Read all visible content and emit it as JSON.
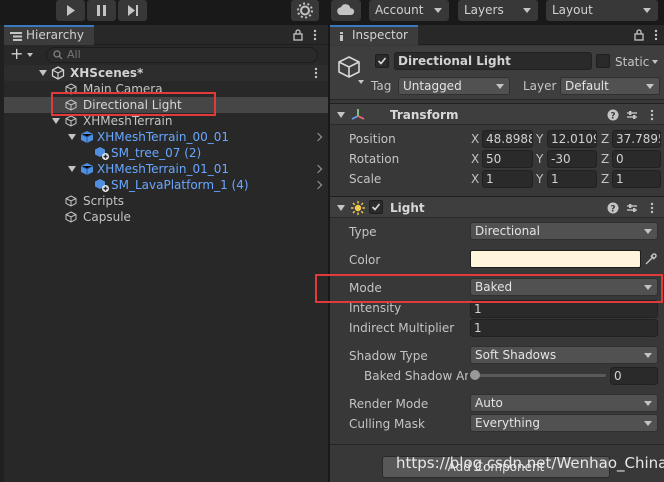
{
  "toolbar": {
    "account_label": "Account",
    "layers_label": "Layers",
    "layout_label": "Layout"
  },
  "hierarchy": {
    "tab_label": "Hierarchy",
    "search_placeholder": "All",
    "scene_name": "XHScenes*",
    "items": [
      {
        "label": "Main Camera"
      },
      {
        "label": "Directional Light"
      },
      {
        "label": "XHMeshTerrain"
      },
      {
        "label": "XHMeshTerrain_00_01"
      },
      {
        "label": "SM_tree_07 (2)"
      },
      {
        "label": "XHMeshTerrain_01_01"
      },
      {
        "label": "SM_LavaPlatform_1 (4)"
      },
      {
        "label": "Scripts"
      },
      {
        "label": "Capsule"
      }
    ]
  },
  "inspector": {
    "tab_label": "Inspector",
    "object_name": "Directional Light",
    "static_label": "Static",
    "tag_label": "Tag",
    "tag_value": "Untagged",
    "layer_label": "Layer",
    "layer_value": "Default",
    "transform": {
      "title": "Transform",
      "position_label": "Position",
      "rotation_label": "Rotation",
      "scale_label": "Scale",
      "x_axis": "X",
      "y_axis": "Y",
      "z_axis": "Z",
      "position": {
        "x": "48.8988",
        "y": "12.0109",
        "z": "37.7895"
      },
      "rotation": {
        "x": "50",
        "y": "-30",
        "z": "0"
      },
      "scale": {
        "x": "1",
        "y": "1",
        "z": "1"
      }
    },
    "light": {
      "title": "Light",
      "type_label": "Type",
      "type_value": "Directional",
      "color_label": "Color",
      "color_value": "#fff4dc",
      "mode_label": "Mode",
      "mode_value": "Baked",
      "intensity_label": "Intensity",
      "intensity_value": "1",
      "indirect_label": "Indirect Multiplier",
      "indirect_value": "1",
      "shadow_type_label": "Shadow Type",
      "shadow_type_value": "Soft Shadows",
      "baked_shadow_label": "Baked Shadow An",
      "baked_shadow_value": "0",
      "render_mode_label": "Render Mode",
      "render_mode_value": "Auto",
      "culling_mask_label": "Culling Mask",
      "culling_mask_value": "Everything"
    },
    "add_component_label": "Add Component"
  },
  "watermark": "https://blog.csdn.net/Wenhao_China",
  "colors": {
    "accent_blue": "#3a79bb",
    "prefab_blue": "#68a7ff",
    "highlight_red": "#e03a3a"
  }
}
